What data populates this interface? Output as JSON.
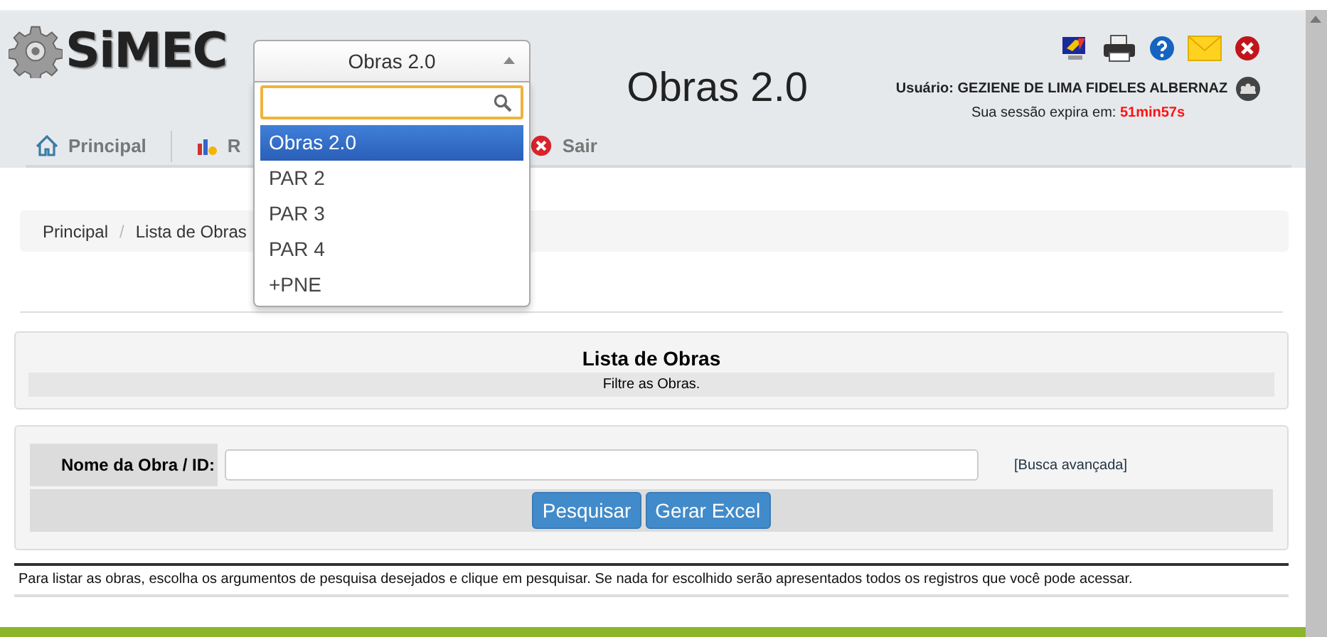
{
  "header": {
    "logo": "SiMEC",
    "title": "Obras 2.0",
    "user_label": "Usuário:",
    "user_name": "GEZIENE DE LIMA FIDELES ALBERNAZ",
    "session_label": "Sua sessão expira em:",
    "session_time": "51min57s"
  },
  "menu": [
    {
      "label": "Principal",
      "kind": "home"
    },
    {
      "label": "R",
      "kind": "chart"
    },
    {
      "label": "Sair",
      "kind": "exit"
    }
  ],
  "system_select": {
    "value": "Obras 2.0",
    "expanded": true,
    "options": [
      {
        "label": "Obras 2.0",
        "selected": true
      },
      {
        "label": "PAR 2",
        "selected": false
      },
      {
        "label": "PAR 3",
        "selected": false
      },
      {
        "label": "PAR 4",
        "selected": false
      },
      {
        "label": "+PNE",
        "selected": false
      }
    ]
  },
  "breadcrumb": [
    {
      "label": "Principal"
    },
    {
      "separator": "/",
      "label": "Lista de Obras"
    }
  ],
  "list_panel": {
    "title": "Lista de Obras",
    "subtitle": "Filtre as Obras."
  },
  "filter": {
    "label": "Nome da Obra / ID:",
    "advanced_link": "[Busca avançada]",
    "buttons": [
      "Pesquisar",
      "Gerar Excel"
    ]
  },
  "note": "Para listar as obras, escolha os argumentos de pesquisa desejados e clique em pesquisar. Se nada for escolhido serão apresentados todos os registros que você pode acessar."
}
